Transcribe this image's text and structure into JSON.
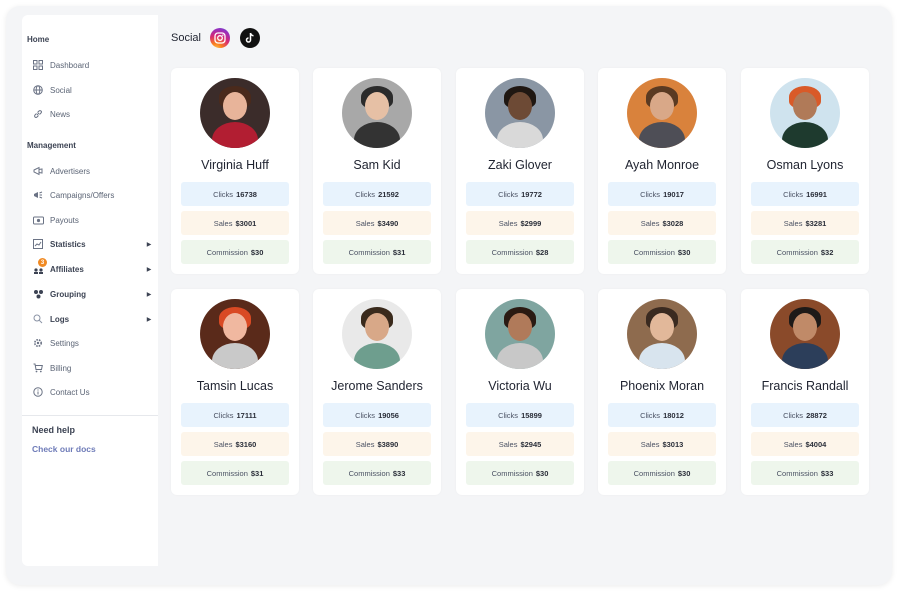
{
  "sidebar": {
    "home_title": "Home",
    "management_title": "Management",
    "items_home": [
      {
        "label": "Dashboard",
        "icon": "dashboard-icon"
      },
      {
        "label": "Social",
        "icon": "globe-icon"
      },
      {
        "label": "News",
        "icon": "link-icon"
      }
    ],
    "items_management": [
      {
        "label": "Advertisers",
        "icon": "megaphone-icon"
      },
      {
        "label": "Campaigns/Offers",
        "icon": "campaign-icon"
      },
      {
        "label": "Payouts",
        "icon": "money-icon"
      },
      {
        "label": "Statistics",
        "icon": "chart-icon"
      },
      {
        "label": "Affiliates",
        "icon": "users-icon",
        "badge": "3"
      },
      {
        "label": "Grouping",
        "icon": "group-icon"
      },
      {
        "label": "Logs",
        "icon": "search-icon"
      },
      {
        "label": "Settings",
        "icon": "gear-icon"
      },
      {
        "label": "Billing",
        "icon": "cart-icon"
      },
      {
        "label": "Contact Us",
        "icon": "info-icon"
      }
    ],
    "help_title": "Need help",
    "help_link": "Check our docs"
  },
  "header": {
    "title": "Social"
  },
  "labels": {
    "clicks": "Clicks",
    "sales": "Sales",
    "commission": "Commission"
  },
  "affiliates": [
    {
      "name": "Virginia Huff",
      "clicks": "16738",
      "sales": "$3001",
      "commission": "$30",
      "bg": "#3b2c2a",
      "skin": "#e8b49a",
      "hair": "#4a2a1c",
      "shirt": "#b21e32"
    },
    {
      "name": "Sam Kid",
      "clicks": "21592",
      "sales": "$3490",
      "commission": "$31",
      "bg": "#a8a8a8",
      "skin": "#e6c0a5",
      "hair": "#2b2b2b",
      "shirt": "#333333"
    },
    {
      "name": "Zaki Glover",
      "clicks": "19772",
      "sales": "$2999",
      "commission": "$28",
      "bg": "#8a96a4",
      "skin": "#6d4a35",
      "hair": "#1f1712",
      "shirt": "#d9d9d9"
    },
    {
      "name": "Ayah Monroe",
      "clicks": "19017",
      "sales": "$3028",
      "commission": "$30",
      "bg": "#d9823c",
      "skin": "#d9a888",
      "hair": "#5a3a22",
      "shirt": "#4e4e56"
    },
    {
      "name": "Osman Lyons",
      "clicks": "16991",
      "sales": "$3281",
      "commission": "$32",
      "bg": "#cfe3ee",
      "skin": "#b07a58",
      "hair": "#d95a28",
      "shirt": "#1e3a2e"
    },
    {
      "name": "Tamsin Lucas",
      "clicks": "17111",
      "sales": "$3160",
      "commission": "$31",
      "bg": "#5a2a1a",
      "skin": "#f0b8a0",
      "hair": "#d94a24",
      "shirt": "#c9c9c9"
    },
    {
      "name": "Jerome Sanders",
      "clicks": "19056",
      "sales": "$3890",
      "commission": "$33",
      "bg": "#e9e9e9",
      "skin": "#d8a888",
      "hair": "#3a2a1c",
      "shirt": "#6e9e8e"
    },
    {
      "name": "Victoria Wu",
      "clicks": "15899",
      "sales": "$2945",
      "commission": "$30",
      "bg": "#7fa5a0",
      "skin": "#b07a5a",
      "hair": "#2a1a12",
      "shirt": "#c8c8c8"
    },
    {
      "name": "Phoenix Moran",
      "clicks": "18012",
      "sales": "$3013",
      "commission": "$30",
      "bg": "#8e6b4e",
      "skin": "#e2b89a",
      "hair": "#3a2a20",
      "shirt": "#d8e4ee"
    },
    {
      "name": "Francis Randall",
      "clicks": "28872",
      "sales": "$4004",
      "commission": "$33",
      "bg": "#8a4a2a",
      "skin": "#c08a68",
      "hair": "#1e1a18",
      "shirt": "#2c3e5a"
    }
  ]
}
